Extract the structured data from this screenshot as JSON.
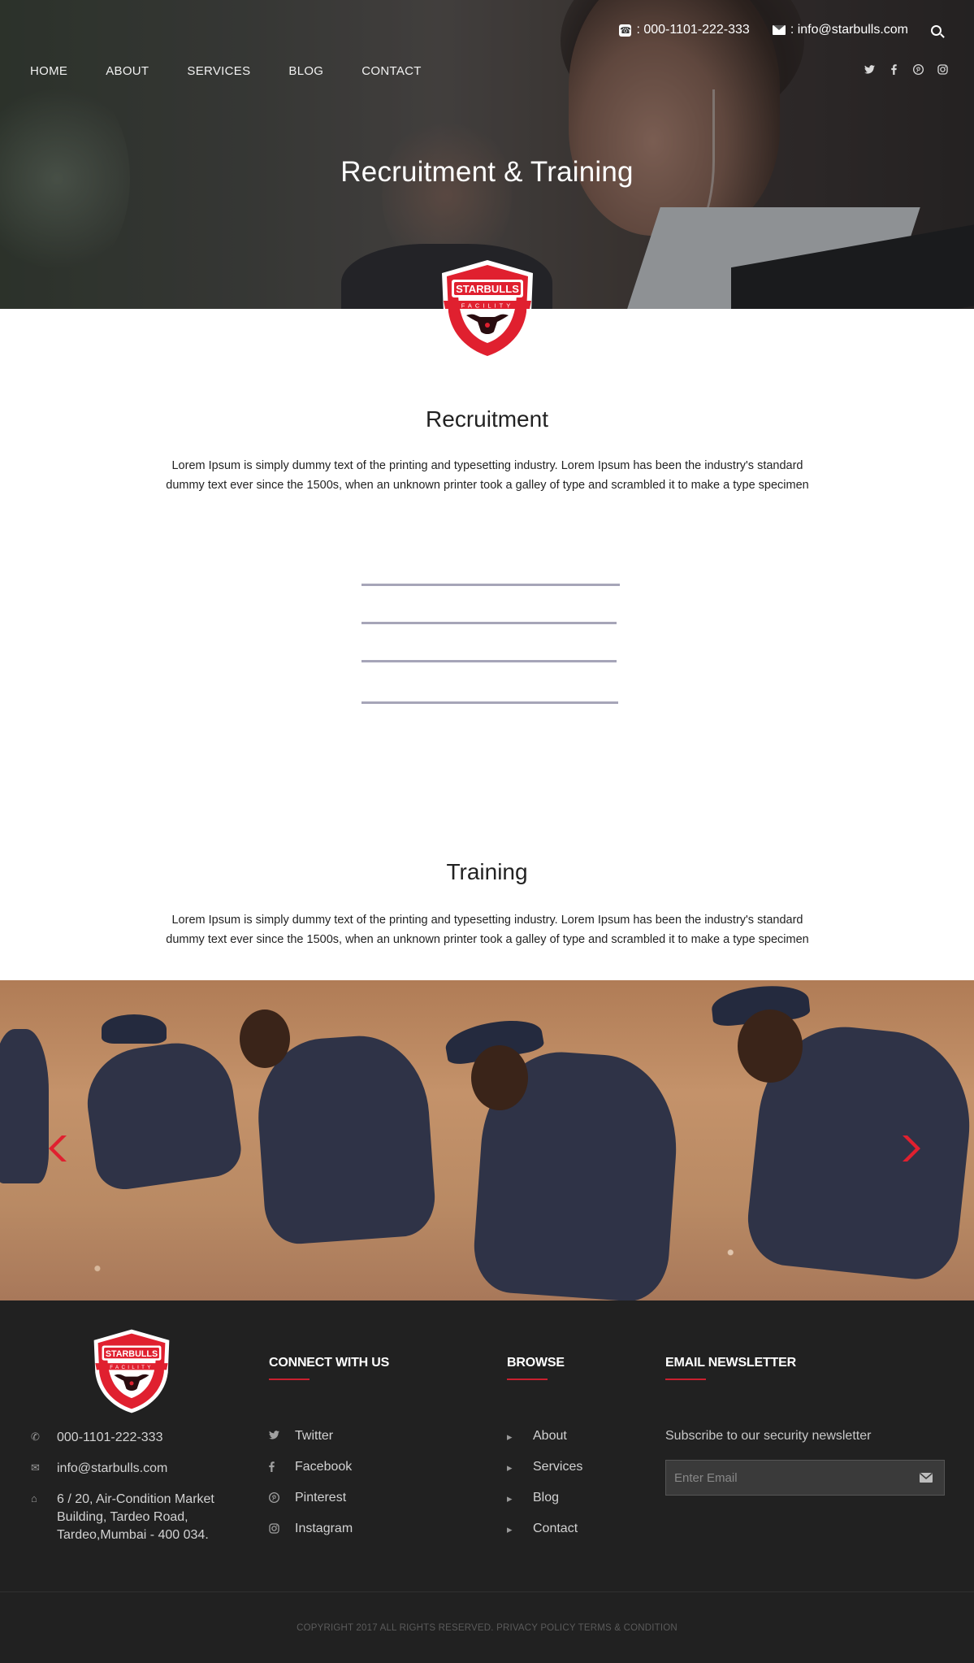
{
  "header": {
    "phone": ": 000-1101-222-333",
    "email": ": info@starbulls.com",
    "nav": [
      "HOME",
      "ABOUT",
      "SERVICES",
      "BLOG",
      "CONTACT"
    ],
    "social_icons": [
      "twitter-icon",
      "facebook-icon",
      "pinterest-icon",
      "instagram-icon"
    ]
  },
  "hero": {
    "title": "Recruitment & Training"
  },
  "logo": {
    "top": "STARBULLS",
    "band": "FACILITY"
  },
  "recruitment": {
    "title": "Recruitment",
    "line1": "Lorem Ipsum is simply dummy text of the printing and typesetting industry. Lorem Ipsum has been the industry's standard",
    "line2": "dummy text ever since the 1500s, when an unknown printer took a galley of type and scrambled it to make a type specimen"
  },
  "training": {
    "title": "Training",
    "line1": "Lorem Ipsum is simply dummy text of the printing and typesetting industry. Lorem Ipsum has been the industry's standard",
    "line2": "dummy text ever since the 1500s, when an unknown printer took a galley of type and scrambled it to make a type specimen"
  },
  "footer": {
    "contact": {
      "phone": "000-1101-222-333",
      "email": "info@starbulls.com",
      "address_line1": "6 / 20, Air-Condition Market",
      "address_line2": "Building, Tardeo Road,",
      "address_line3": "Tardeo,Mumbai - 400 034."
    },
    "connect": {
      "title": "CONNECT WITH US",
      "items": [
        "Twitter",
        "Facebook",
        "Pinterest",
        "Instagram"
      ]
    },
    "browse": {
      "title": "BROWSE",
      "items": [
        "About",
        "Services",
        "Blog",
        "Contact"
      ]
    },
    "newsletter": {
      "title": "EMAIL NEWSLETTER",
      "text": "Subscribe to our security newsletter",
      "placeholder": "Enter Email"
    },
    "copyright": "COPYRIGHT 2017 ALL RIGHTS RESERVED. PRIVACY POLICY TERMS & CONDITION"
  },
  "colors": {
    "accent": "#e0202f",
    "footer_bg": "#212121",
    "divider_lines": "#a6a5b8"
  }
}
